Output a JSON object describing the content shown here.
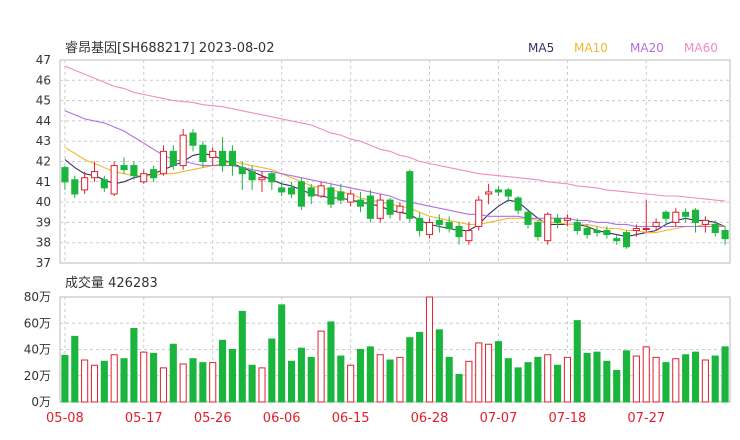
{
  "chart_data": [
    {
      "type": "candlestick",
      "title": "睿昂基因[SH688217] 2023-08-02",
      "legend_position": "top-right",
      "legend": [
        {
          "name": "MA5",
          "color": "#333366"
        },
        {
          "name": "MA10",
          "color": "#f5b731"
        },
        {
          "name": "MA20",
          "color": "#b36fe0"
        },
        {
          "name": "MA60",
          "color": "#f08cc4"
        }
      ],
      "up_color": "#e0202f",
      "down_color": "#1bb53d",
      "ylim": [
        37,
        47
      ],
      "yticks": [
        "47",
        "46",
        "45",
        "44",
        "43",
        "42",
        "41",
        "40",
        "39",
        "38",
        "37"
      ],
      "grid": true,
      "candles": [
        [
          41.7,
          41.0,
          41.8,
          40.6
        ],
        [
          41.1,
          40.4,
          41.3,
          40.2
        ],
        [
          40.6,
          41.2,
          41.5,
          40.4
        ],
        [
          41.2,
          41.5,
          42.0,
          41.0
        ],
        [
          41.1,
          40.7,
          41.3,
          40.5
        ],
        [
          40.4,
          41.8,
          42.0,
          40.3
        ],
        [
          41.8,
          41.6,
          42.2,
          41.4
        ],
        [
          41.8,
          41.3,
          42.0,
          41.1
        ],
        [
          41.0,
          41.4,
          41.6,
          40.9
        ],
        [
          41.6,
          41.2,
          41.8,
          41.0
        ],
        [
          41.4,
          42.5,
          42.8,
          41.3
        ],
        [
          42.5,
          41.8,
          42.8,
          41.6
        ],
        [
          41.8,
          43.3,
          43.6,
          41.6
        ],
        [
          43.4,
          42.8,
          43.6,
          42.5
        ],
        [
          42.8,
          42.0,
          43.0,
          41.7
        ],
        [
          42.2,
          42.5,
          42.7,
          41.8
        ],
        [
          42.5,
          41.8,
          43.2,
          41.5
        ],
        [
          42.5,
          41.8,
          42.8,
          41.3
        ],
        [
          41.7,
          41.4,
          42.0,
          40.6
        ],
        [
          41.5,
          41.1,
          41.8,
          40.6
        ],
        [
          41.1,
          41.2,
          41.5,
          40.5
        ],
        [
          41.4,
          41.0,
          41.5,
          40.6
        ],
        [
          40.7,
          40.5,
          41.0,
          40.3
        ],
        [
          40.7,
          40.4,
          41.0,
          40.2
        ],
        [
          41.0,
          39.8,
          41.2,
          39.6
        ],
        [
          40.7,
          40.3,
          40.9,
          39.9
        ],
        [
          40.3,
          40.8,
          41.0,
          40.2
        ],
        [
          40.7,
          39.9,
          40.9,
          39.7
        ],
        [
          40.5,
          40.1,
          40.9,
          39.9
        ],
        [
          40.0,
          40.4,
          40.6,
          39.8
        ],
        [
          40.1,
          39.8,
          40.5,
          39.5
        ],
        [
          40.3,
          39.2,
          40.6,
          39.0
        ],
        [
          39.2,
          40.1,
          40.4,
          39.0
        ],
        [
          40.1,
          39.4,
          40.2,
          39.2
        ],
        [
          39.5,
          39.8,
          40.0,
          39.1
        ],
        [
          41.5,
          39.2,
          41.6,
          39.0
        ],
        [
          39.2,
          38.6,
          39.5,
          38.3
        ],
        [
          38.4,
          39.0,
          39.2,
          38.2
        ],
        [
          39.1,
          38.9,
          39.4,
          38.5
        ],
        [
          39.0,
          38.7,
          39.3,
          38.5
        ],
        [
          38.8,
          38.3,
          39.0,
          37.9
        ],
        [
          38.1,
          38.6,
          39.0,
          37.9
        ],
        [
          38.8,
          40.1,
          40.3,
          38.6
        ],
        [
          40.4,
          40.5,
          40.9,
          39.9
        ],
        [
          40.6,
          40.5,
          40.8,
          40.3
        ],
        [
          40.6,
          40.3,
          40.7,
          40.0
        ],
        [
          40.2,
          39.6,
          40.3,
          39.4
        ],
        [
          39.5,
          38.9,
          39.6,
          38.7
        ],
        [
          39.0,
          38.3,
          39.1,
          38.1
        ],
        [
          38.1,
          39.4,
          39.5,
          37.9
        ],
        [
          39.2,
          39.0,
          39.4,
          38.7
        ],
        [
          39.1,
          39.2,
          39.4,
          38.8
        ],
        [
          39.0,
          38.6,
          39.2,
          38.4
        ],
        [
          38.7,
          38.4,
          38.9,
          38.2
        ],
        [
          38.6,
          38.5,
          38.8,
          38.3
        ],
        [
          38.6,
          38.4,
          38.8,
          38.2
        ],
        [
          38.2,
          38.1,
          38.4,
          37.9
        ],
        [
          38.5,
          37.8,
          38.6,
          37.7
        ],
        [
          38.6,
          38.7,
          38.9,
          38.3
        ],
        [
          38.7,
          38.7,
          40.1,
          38.5
        ],
        [
          38.8,
          39.0,
          39.2,
          38.6
        ],
        [
          39.5,
          39.2,
          39.6,
          38.9
        ],
        [
          39.0,
          39.5,
          39.7,
          38.8
        ],
        [
          39.5,
          39.3,
          39.7,
          39.0
        ],
        [
          39.6,
          39.0,
          39.7,
          38.5
        ],
        [
          38.9,
          39.1,
          39.3,
          38.5
        ],
        [
          38.9,
          38.5,
          39.1,
          38.3
        ],
        [
          38.6,
          38.2,
          38.8,
          37.9
        ]
      ],
      "ma": {
        "MA5": [
          42.1,
          41.7,
          41.4,
          41.3,
          41.1,
          40.9,
          41.0,
          41.2,
          41.3,
          41.4,
          41.6,
          41.8,
          42.0,
          42.3,
          42.4,
          42.3,
          42.1,
          41.9,
          41.7,
          41.5,
          41.3,
          41.1,
          40.9,
          40.8,
          40.6,
          40.4,
          40.3,
          40.2,
          40.2,
          40.1,
          40.0,
          39.9,
          39.8,
          39.6,
          39.5,
          39.4,
          39.1,
          38.9,
          38.8,
          38.7,
          38.6,
          38.6,
          38.9,
          39.4,
          39.8,
          40.1,
          40.0,
          39.6,
          39.2,
          38.9,
          38.9,
          38.9,
          38.9,
          38.8,
          38.6,
          38.5,
          38.4,
          38.3,
          38.4,
          38.5,
          38.6,
          38.9,
          39.1,
          39.2,
          39.1,
          39.1,
          39.0,
          38.8
        ],
        "MA10": [
          42.7,
          42.4,
          42.1,
          41.9,
          41.7,
          41.5,
          41.4,
          41.3,
          41.3,
          41.3,
          41.4,
          41.4,
          41.5,
          41.6,
          41.7,
          41.8,
          41.9,
          42.0,
          41.9,
          41.8,
          41.7,
          41.6,
          41.4,
          41.2,
          41.0,
          40.8,
          40.7,
          40.6,
          40.5,
          40.4,
          40.2,
          40.1,
          40.0,
          39.9,
          39.8,
          39.7,
          39.5,
          39.3,
          39.2,
          39.1,
          39.0,
          38.9,
          38.9,
          39.0,
          39.1,
          39.2,
          39.2,
          39.2,
          39.1,
          39.0,
          39.0,
          38.9,
          38.9,
          38.9,
          38.8,
          38.7,
          38.7,
          38.6,
          38.6,
          38.5,
          38.5,
          38.6,
          38.7,
          38.8,
          38.8,
          38.9,
          38.9,
          38.8
        ],
        "MA20": [
          44.5,
          44.3,
          44.1,
          44.0,
          43.9,
          43.7,
          43.5,
          43.2,
          42.9,
          42.6,
          42.3,
          42.1,
          42.0,
          41.9,
          41.8,
          41.8,
          41.8,
          41.8,
          41.7,
          41.6,
          41.5,
          41.5,
          41.4,
          41.3,
          41.2,
          41.1,
          41.0,
          40.9,
          40.8,
          40.7,
          40.6,
          40.5,
          40.4,
          40.3,
          40.1,
          40.0,
          39.9,
          39.8,
          39.7,
          39.6,
          39.5,
          39.4,
          39.4,
          39.3,
          39.3,
          39.3,
          39.3,
          39.2,
          39.2,
          39.2,
          39.2,
          39.2,
          39.1,
          39.1,
          39.0,
          39.0,
          38.9,
          38.9,
          38.8,
          38.8,
          38.8,
          38.8,
          38.8,
          38.8,
          38.8,
          38.8,
          38.8,
          38.8
        ],
        "MA60": [
          46.7,
          46.5,
          46.3,
          46.1,
          45.9,
          45.7,
          45.6,
          45.4,
          45.3,
          45.2,
          45.1,
          45.0,
          44.95,
          44.9,
          44.8,
          44.75,
          44.7,
          44.6,
          44.5,
          44.4,
          44.3,
          44.2,
          44.1,
          44.0,
          43.9,
          43.8,
          43.6,
          43.4,
          43.3,
          43.1,
          43.0,
          42.8,
          42.6,
          42.5,
          42.3,
          42.2,
          42.0,
          41.9,
          41.8,
          41.7,
          41.6,
          41.5,
          41.4,
          41.35,
          41.3,
          41.25,
          41.2,
          41.15,
          41.1,
          41.0,
          40.95,
          40.9,
          40.8,
          40.75,
          40.7,
          40.6,
          40.55,
          40.5,
          40.45,
          40.4,
          40.35,
          40.3,
          40.3,
          40.25,
          40.2,
          40.15,
          40.1,
          40.05
        ]
      }
    },
    {
      "type": "bar",
      "title": "成交量 426283",
      "ylim": [
        0,
        800000
      ],
      "yticks": [
        "80万",
        "60万",
        "40万",
        "20万",
        "0万"
      ],
      "x_tick_labels": [
        "05-08",
        "05-17",
        "05-26",
        "06-06",
        "06-15",
        "06-28",
        "07-07",
        "07-18",
        "07-27"
      ],
      "x_tick_indices": [
        0,
        8,
        15,
        22,
        29,
        37,
        44,
        51,
        59
      ],
      "grid": true,
      "values": [
        355000,
        500000,
        320000,
        280000,
        310000,
        360000,
        330000,
        560000,
        380000,
        370000,
        260000,
        440000,
        290000,
        330000,
        300000,
        300000,
        470000,
        400000,
        690000,
        280000,
        260000,
        480000,
        740000,
        310000,
        410000,
        340000,
        540000,
        610000,
        350000,
        280000,
        400000,
        420000,
        360000,
        320000,
        340000,
        490000,
        530000,
        800000,
        550000,
        340000,
        210000,
        310000,
        450000,
        440000,
        460000,
        330000,
        260000,
        300000,
        340000,
        360000,
        280000,
        340000,
        620000,
        370000,
        380000,
        310000,
        240000,
        390000,
        350000,
        420000,
        340000,
        300000,
        330000,
        360000,
        380000,
        320000,
        350000,
        420000
      ],
      "value_precision": "estimated"
    }
  ]
}
